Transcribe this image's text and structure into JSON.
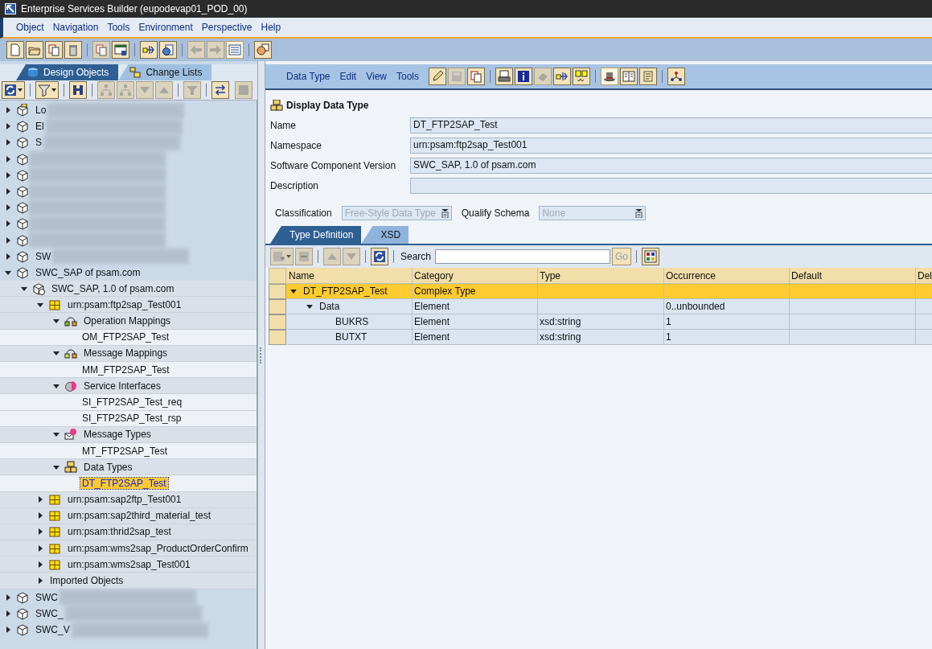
{
  "window": {
    "title": "Enterprise Services Builder (eupodevap01_POD_00)"
  },
  "menu": [
    "Object",
    "Navigation",
    "Tools",
    "Environment",
    "Perspective",
    "Help"
  ],
  "toolbar": [
    {
      "kind": "new",
      "disabled": false
    },
    {
      "kind": "open",
      "disabled": false
    },
    {
      "kind": "copy",
      "disabled": false
    },
    {
      "kind": "delete",
      "disabled": false
    },
    {
      "kind": "sep"
    },
    {
      "kind": "copy",
      "disabled": true
    },
    {
      "kind": "window",
      "disabled": false
    },
    {
      "kind": "sep"
    },
    {
      "kind": "transfer",
      "disabled": false
    },
    {
      "kind": "query",
      "disabled": false
    },
    {
      "kind": "sep"
    },
    {
      "kind": "back",
      "disabled": true
    },
    {
      "kind": "forward",
      "disabled": true
    },
    {
      "kind": "list",
      "disabled": false,
      "pressed": true
    },
    {
      "kind": "sep"
    },
    {
      "kind": "person",
      "disabled": false
    }
  ],
  "left_tabs": [
    {
      "label": "Design Objects",
      "selected": true
    },
    {
      "label": "Change Lists",
      "selected": false
    }
  ],
  "tree_toolbar": [
    {
      "kind": "refresh",
      "disabled": false,
      "dropdown": true
    },
    {
      "kind": "sep"
    },
    {
      "kind": "filter",
      "disabled": false,
      "dropdown": true
    },
    {
      "kind": "sep"
    },
    {
      "kind": "binoculars",
      "disabled": false
    },
    {
      "kind": "sep"
    },
    {
      "kind": "hierarchy",
      "disabled": true
    },
    {
      "kind": "hierarchy",
      "disabled": true
    },
    {
      "kind": "down",
      "disabled": true
    },
    {
      "kind": "up",
      "disabled": true
    },
    {
      "kind": "sep"
    },
    {
      "kind": "funnel",
      "disabled": true
    },
    {
      "kind": "sep"
    },
    {
      "kind": "swap",
      "disabled": false
    },
    {
      "kind": "spacer"
    },
    {
      "kind": "stop",
      "disabled": true
    }
  ],
  "tree": [
    {
      "kind": "box",
      "label": "Lo",
      "redacted": true,
      "expanded": false
    },
    {
      "kind": "swc",
      "label": "El",
      "redacted": true,
      "expanded": false
    },
    {
      "kind": "swc",
      "label": "S",
      "redacted": true,
      "expanded": false
    },
    {
      "kind": "swc",
      "redacted": true,
      "expanded": false
    },
    {
      "kind": "swc",
      "redacted": true,
      "expanded": false
    },
    {
      "kind": "swc",
      "redacted": true,
      "expanded": false
    },
    {
      "kind": "swc",
      "redacted": true,
      "expanded": false
    },
    {
      "kind": "swc",
      "redacted": true,
      "expanded": false
    },
    {
      "kind": "swc",
      "redacted": true,
      "expanded": false
    },
    {
      "kind": "swc",
      "label": "SW",
      "redacted": true,
      "expanded": false
    },
    {
      "kind": "swc",
      "label": "SWC_SAP of psam.com",
      "expanded": true,
      "selected": false,
      "children": [
        {
          "kind": "swcv",
          "label": "SWC_SAP, 1.0 of psam.com",
          "expanded": true,
          "selected": false,
          "children": [
            {
              "kind": "namespace",
              "label": "urn:psam:ftp2sap_Test001",
              "expanded": true,
              "selected": false,
              "children": [
                {
                  "kind": "operation-mapping",
                  "label": "Operation Mappings",
                  "expanded": true,
                  "selected": false,
                  "children": [
                    {
                      "label": "OM_FTP2SAP_Test",
                      "selected": false
                    }
                  ]
                },
                {
                  "kind": "message-mapping",
                  "label": "Message Mappings",
                  "expanded": true,
                  "selected": false,
                  "children": [
                    {
                      "label": "MM_FTP2SAP_Test",
                      "selected": false
                    }
                  ]
                },
                {
                  "kind": "service-interface",
                  "label": "Service Interfaces",
                  "expanded": true,
                  "selected": false,
                  "children": [
                    {
                      "label": "SI_FTP2SAP_Test_req",
                      "selected": false
                    },
                    {
                      "label": "SI_FTP2SAP_Test_rsp",
                      "selected": false
                    }
                  ]
                },
                {
                  "kind": "message-type",
                  "label": "Message Types",
                  "expanded": true,
                  "selected": false,
                  "children": [
                    {
                      "label": "MT_FTP2SAP_Test",
                      "selected": false
                    }
                  ]
                },
                {
                  "kind": "data-type",
                  "label": "Data Types",
                  "expanded": true,
                  "selected": false,
                  "children": [
                    {
                      "label": "DT_FTP2SAP_Test",
                      "selected": true
                    }
                  ]
                }
              ]
            },
            {
              "kind": "namespace",
              "label": "urn:psam:sap2ftp_Test001",
              "expanded": false,
              "selected": false
            },
            {
              "kind": "namespace",
              "label": "urn:psam:sap2third_material_test",
              "expanded": false,
              "selected": false
            },
            {
              "kind": "namespace",
              "label": "urn:psam:thrid2sap_test",
              "expanded": false,
              "selected": false
            },
            {
              "kind": "namespace",
              "label": "urn:psam:wms2sap_ProductOrderConfirm",
              "expanded": false,
              "selected": false
            },
            {
              "kind": "namespace",
              "label": "urn:psam:wms2sap_Test001",
              "expanded": false,
              "selected": false
            },
            {
              "label": "Imported Objects",
              "expanded": false,
              "selected": false
            }
          ]
        }
      ]
    },
    {
      "kind": "swc",
      "label": "SWC",
      "redacted": true,
      "expanded": false
    },
    {
      "kind": "swc",
      "label": "SWC_",
      "redacted": true,
      "expanded": false
    },
    {
      "kind": "swc",
      "label": "SWC_V",
      "redacted": true,
      "expanded": false
    }
  ],
  "editor": {
    "menu": [
      "Data Type",
      "Edit",
      "View",
      "Tools"
    ],
    "toolbar": [
      {
        "kind": "edit",
        "disabled": false
      },
      {
        "kind": "save",
        "disabled": true
      },
      {
        "kind": "copy",
        "disabled": false
      },
      {
        "kind": "sep"
      },
      {
        "kind": "print",
        "disabled": false
      },
      {
        "kind": "info",
        "disabled": false
      },
      {
        "kind": "eraser",
        "disabled": true
      },
      {
        "kind": "transfer",
        "disabled": false
      },
      {
        "kind": "compare",
        "disabled": false
      },
      {
        "kind": "sep"
      },
      {
        "kind": "hat",
        "disabled": false,
        "pressed": true
      },
      {
        "kind": "book",
        "disabled": false
      },
      {
        "kind": "scroll",
        "disabled": false
      },
      {
        "kind": "sep"
      },
      {
        "kind": "network",
        "disabled": false
      }
    ],
    "title": "Display Data Type",
    "fields": [
      {
        "label": "Name",
        "value": "DT_FTP2SAP_Test"
      },
      {
        "label": "Namespace",
        "value": "urn:psam:ftp2sap_Test001"
      },
      {
        "label": "Software Component Version",
        "value": "SWC_SAP, 1.0 of psam.com"
      },
      {
        "label": "Description"
      }
    ],
    "classification": {
      "label": "Classification",
      "value": "Free-Style Data Type",
      "disabled": true
    },
    "qualify_schema": {
      "label": "Qualify Schema",
      "value": "None",
      "disabled": true
    },
    "tabs": [
      {
        "label": "Type Definition",
        "selected": true
      },
      {
        "label": "XSD",
        "selected": false
      }
    ],
    "table_toolbar": [
      {
        "kind": "add",
        "disabled": true,
        "dropdown": true
      },
      {
        "kind": "remove",
        "disabled": true
      },
      {
        "kind": "sep"
      },
      {
        "kind": "up",
        "disabled": true
      },
      {
        "kind": "down",
        "disabled": true
      },
      {
        "kind": "sep"
      },
      {
        "kind": "refresh",
        "disabled": false
      }
    ],
    "search": {
      "label": "Search",
      "button": "Go"
    },
    "table": {
      "columns": [
        "Name",
        "Category",
        "Type",
        "Occurrence",
        "Default",
        "Del"
      ],
      "rows": [
        {
          "name": "DT_FTP2SAP_Test",
          "category": "Complex Type",
          "expanded": true,
          "selected": true,
          "children": [
            {
              "name": "Data",
              "category": "Element",
              "occurrence": "0..unbounded",
              "expanded": true,
              "selected": false,
              "children": [
                {
                  "name": "BUKRS",
                  "category": "Element",
                  "type": "xsd:string",
                  "occurrence": "1",
                  "selected": false
                },
                {
                  "name": "BUTXT",
                  "category": "Element",
                  "type": "xsd:string",
                  "occurrence": "1",
                  "selected": false
                }
              ]
            }
          ]
        }
      ]
    }
  }
}
